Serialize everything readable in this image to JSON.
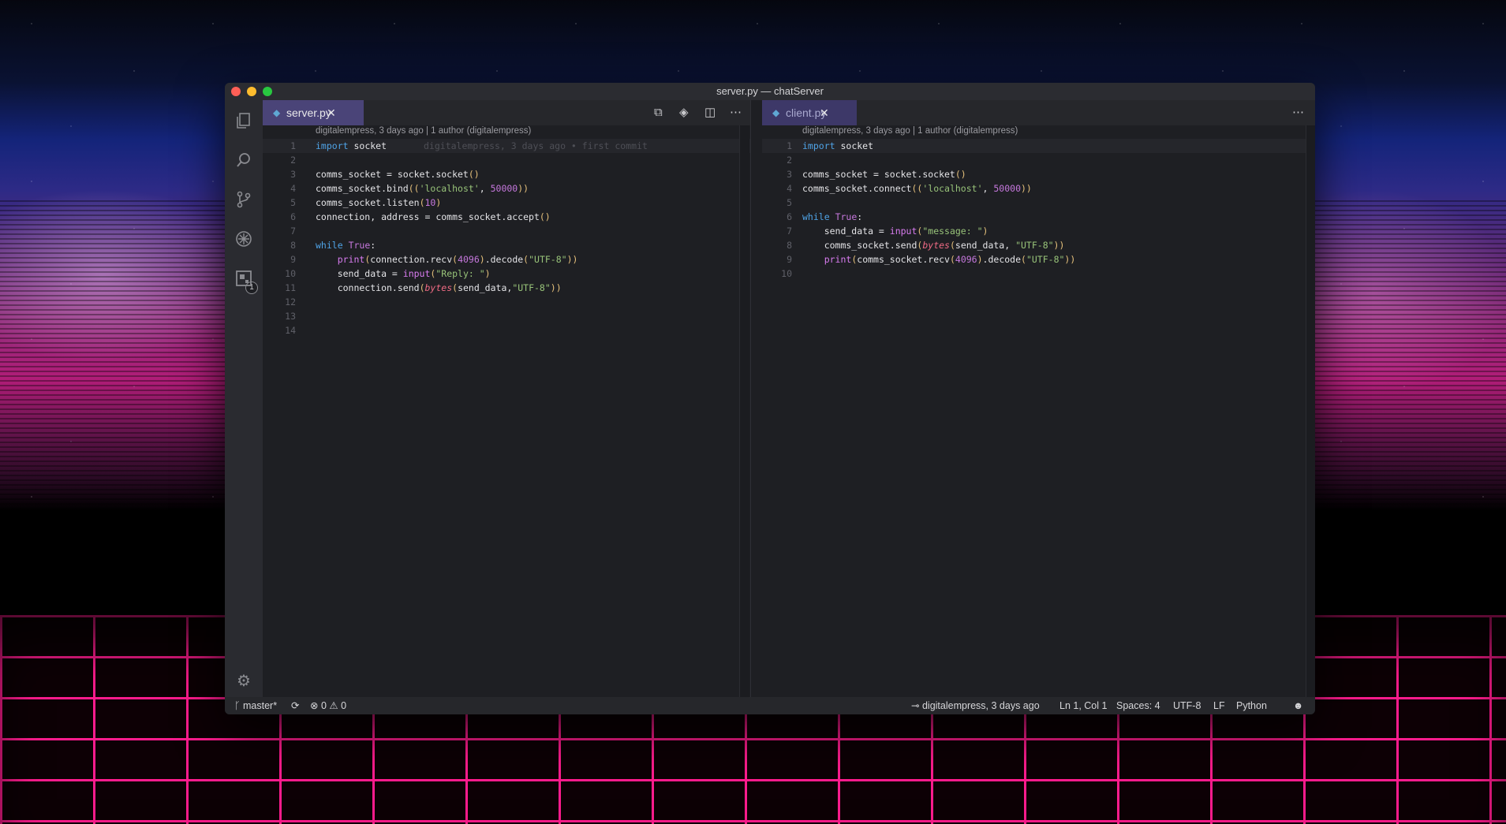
{
  "window": {
    "title": "server.py — chatServer"
  },
  "colors": {
    "accent_tab": "#4a4478",
    "editor_bg": "#1e1f23",
    "grid": "#ff1c8e"
  },
  "activity_bar": {
    "icons": [
      "files-icon",
      "search-icon",
      "source-control-icon",
      "debug-icon",
      "extensions-icon",
      "gear-icon"
    ],
    "scm_badge": "1"
  },
  "left_editor": {
    "tab_label": "server.py",
    "blame_header": "digitalempress, 3 days ago | 1 author (digitalempress)",
    "inline_blame": "digitalempress, 3 days ago • first commit",
    "line_numbers": [
      "1",
      "2",
      "3",
      "4",
      "5",
      "6",
      "7",
      "8",
      "9",
      "10",
      "11",
      "12",
      "13",
      "14"
    ],
    "lines": [
      "import socket",
      "",
      "comms_socket = socket.socket()",
      "comms_socket.bind(('localhost', 50000))",
      "comms_socket.listen(10)",
      "connection, address = comms_socket.accept()",
      "",
      "while True:",
      "    print(connection.recv(4096).decode(\"UTF-8\"))",
      "    send_data = input(\"Reply: \")",
      "    connection.send(bytes(send_data,\"UTF-8\"))",
      "",
      "",
      ""
    ]
  },
  "right_editor": {
    "tab_label": "client.py",
    "blame_header": "digitalempress, 3 days ago | 1 author (digitalempress)",
    "line_numbers": [
      "1",
      "2",
      "3",
      "4",
      "5",
      "6",
      "7",
      "8",
      "9",
      "10"
    ],
    "lines": [
      "import socket",
      "",
      "comms_socket = socket.socket()",
      "comms_socket.connect(('localhost', 50000))",
      "",
      "while True:",
      "    send_data = input(\"message: \")",
      "    comms_socket.send(bytes(send_data, \"UTF-8\"))",
      "    print(comms_socket.recv(4096).decode(\"UTF-8\"))",
      ""
    ]
  },
  "status_bar": {
    "branch": "master*",
    "errors": "0",
    "warnings": "0",
    "blame": "digitalempress, 3 days ago",
    "cursor": "Ln 1, Col 1",
    "spaces": "Spaces: 4",
    "encoding": "UTF-8",
    "eol": "LF",
    "language": "Python"
  }
}
